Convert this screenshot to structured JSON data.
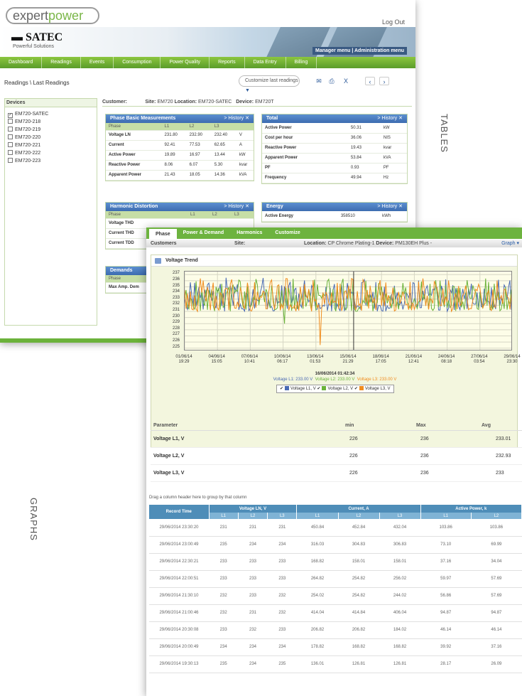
{
  "brand": {
    "logo_pre": "expert",
    "logo_post": "power",
    "satec": "SATEC",
    "satec_sub": "Powerful Solutions",
    "manager": "Manager menu | Administration menu"
  },
  "header": {
    "logout": "Log Out"
  },
  "nav": [
    "Dashboard",
    "Readings",
    "Events",
    "Consumption",
    "Power Quality",
    "Reports",
    "Data Entry",
    "Billing"
  ],
  "breadcrumb": "Readings \\ Last Readings",
  "customize": "Customize last readings",
  "devices": {
    "title": "Devices",
    "items": [
      {
        "name": "EM720-SATEC",
        "checked": true
      },
      {
        "name": "EM720-218",
        "checked": false
      },
      {
        "name": "EM720-219",
        "checked": false
      },
      {
        "name": "EM720-220",
        "checked": false
      },
      {
        "name": "EM720-221",
        "checked": false
      },
      {
        "name": "EM720-222",
        "checked": false
      },
      {
        "name": "EM720-223",
        "checked": false
      }
    ]
  },
  "customer_bar": {
    "customer": "Customer:",
    "site": "Site:",
    "site_val": "EM720",
    "location": "Location:",
    "location_val": "EM720-SATEC",
    "device": "Device:",
    "device_val": "EM720T"
  },
  "phase_basic": {
    "title": "Phase Basic Measurements",
    "history": "> History",
    "cols": [
      "Phase",
      "L1",
      "L2",
      "L3",
      ""
    ],
    "rows": [
      [
        "Voltage LN",
        "231.80",
        "232.90",
        "232.40",
        "V"
      ],
      [
        "Current",
        "92.41",
        "77.53",
        "62.65",
        "A"
      ],
      [
        "Active Power",
        "19.89",
        "16.97",
        "13.44",
        "kW"
      ],
      [
        "Reactive Power",
        "8.06",
        "6.07",
        "5.30",
        "kvar"
      ],
      [
        "Apparent Power",
        "21.43",
        "18.05",
        "14.36",
        "kVA"
      ]
    ]
  },
  "total": {
    "title": "Total",
    "history": "> History",
    "rows": [
      [
        "Active Power",
        "50.31",
        "kW"
      ],
      [
        "Cost per hour",
        "36.06",
        "NIS"
      ],
      [
        "Reactive Power",
        "19.43",
        "kvar"
      ],
      [
        "Apparent Power",
        "53.84",
        "kVA"
      ],
      [
        "PF",
        "0.93",
        "PF"
      ],
      [
        "Frequency",
        "49.94",
        "Hz"
      ]
    ]
  },
  "harmonic": {
    "title": "Harmonic Distortion",
    "history": "> History",
    "cols": [
      "Phase",
      "L1",
      "L2",
      "L3"
    ],
    "rows": [
      "Voltage THD",
      "Current THD",
      "Current TDD"
    ]
  },
  "energy": {
    "title": "Energy",
    "history": "> History",
    "rows": [
      [
        "Active Energy",
        "358510",
        "kWh"
      ]
    ]
  },
  "demands": {
    "title": "Demands",
    "cols": [
      "Phase"
    ],
    "rows": [
      "Max Amp. Dem"
    ]
  },
  "win2": {
    "tabs": [
      "Phase",
      "Power & Demand",
      "Harmonics",
      "Customize"
    ],
    "customer": "Customers",
    "site": "Site:",
    "location": "Location:",
    "location_val": "CP Chrome Plating-1",
    "device": "Device:",
    "device_val": "PM130EH Plus -",
    "graph": "Graph ▾",
    "trend_title": "Voltage Trend"
  },
  "chart_data": {
    "type": "line",
    "title": "Voltage Trend",
    "yticks": [
      237,
      236,
      235,
      234,
      233,
      232,
      231,
      230,
      229,
      228,
      227,
      226,
      225
    ],
    "ylim": [
      224.5,
      237.5
    ],
    "xticks": [
      "01/06/14 19:29",
      "04/06/14 15:05",
      "07/06/14 10:41",
      "10/06/14 06:17",
      "13/06/14 01:53",
      "15/06/14 21:29",
      "18/06/14 17:05",
      "21/06/14 12:41",
      "24/06/14 08:18",
      "27/06/14 03:54",
      "29/06/14 23:30"
    ],
    "series": [
      {
        "name": "Voltage L1, V",
        "color": "#4a6ab4"
      },
      {
        "name": "Voltage L2, V",
        "color": "#6ab23a"
      },
      {
        "name": "Voltage L3, V",
        "color": "#f08c1e"
      }
    ],
    "cursor": {
      "time": "16/06/2014 01:42:34",
      "L1": "Voltage L1: 233.00 V",
      "L2": "Voltage L2: 233.00 V",
      "L3": "Voltage L3: 233.00 V"
    }
  },
  "stats": {
    "header": [
      "Parameter",
      "min",
      "Max",
      "Avg"
    ],
    "rows": [
      [
        "Voltage L1, V",
        "226",
        "236",
        "233.01"
      ],
      [
        "Voltage L2, V",
        "226",
        "236",
        "232.93"
      ],
      [
        "Voltage L3, V",
        "226",
        "236",
        "233"
      ]
    ]
  },
  "drag_hint": "Drag a column header here to group by that column",
  "grid": {
    "groups": [
      "Record Time",
      "Voltage LN, V",
      "Current, A",
      "Active Power, k"
    ],
    "sub": [
      "L1",
      "L2",
      "L3",
      "L1",
      "L2",
      "L3",
      "L1",
      "L2"
    ],
    "rows": [
      [
        "29/06/2014 23:30:20",
        "231",
        "231",
        "231",
        "450.84",
        "452.84",
        "432.04",
        "103.86",
        "103.86"
      ],
      [
        "29/06/2014 23:00:49",
        "235",
        "234",
        "234",
        "316.03",
        "304.83",
        "306.83",
        "73.10",
        "69.99"
      ],
      [
        "29/06/2014 22:30:21",
        "233",
        "233",
        "233",
        "168.82",
        "158.01",
        "158.01",
        "37.16",
        "34.04"
      ],
      [
        "29/06/2014 22:00:51",
        "233",
        "233",
        "233",
        "264.82",
        "254.82",
        "256.02",
        "59.97",
        "57.69"
      ],
      [
        "29/06/2014 21:30:10",
        "232",
        "233",
        "232",
        "254.02",
        "254.82",
        "244.02",
        "56.86",
        "57.69"
      ],
      [
        "29/06/2014 21:00:46",
        "232",
        "231",
        "232",
        "414.04",
        "414.84",
        "406.04",
        "94.87",
        "94.87"
      ],
      [
        "29/06/2014 20:30:08",
        "233",
        "232",
        "233",
        "206.82",
        "206.82",
        "184.02",
        "46.14",
        "46.14"
      ],
      [
        "29/06/2014 20:00:49",
        "234",
        "234",
        "234",
        "178.82",
        "168.82",
        "168.82",
        "39.92",
        "37.16"
      ],
      [
        "29/06/2014 19:30:13",
        "235",
        "234",
        "235",
        "136.01",
        "126.81",
        "126.81",
        "28.17",
        "26.09"
      ]
    ]
  },
  "side": {
    "tables": "TABLES",
    "graphs": "GRAPHS"
  }
}
